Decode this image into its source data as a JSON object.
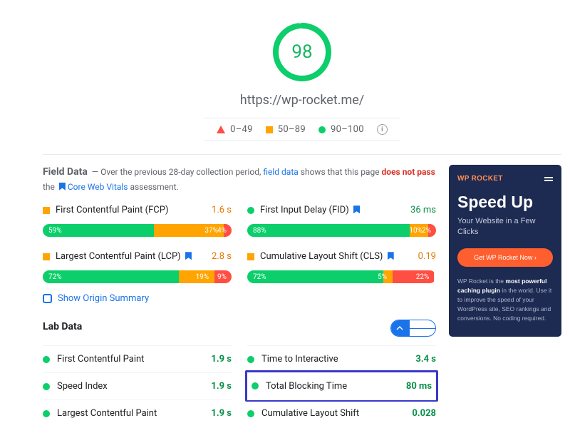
{
  "score": 98,
  "url": "https://wp-rocket.me/",
  "legend": {
    "bad": "0–49",
    "mid": "50–89",
    "good": "90–100"
  },
  "field": {
    "title": "Field Data",
    "intro_1": "— Over the previous 28-day collection period, ",
    "link_1": "field data",
    "intro_2": " shows that this page ",
    "fail": "does not pass",
    "intro_3": " the ",
    "link_2": "Core Web Vitals",
    "intro_4": " assessment."
  },
  "field_metrics": [
    {
      "name": "First Contentful Paint (FCP)",
      "value": "1.6 s",
      "color": "orange",
      "bookmark": false,
      "marker": "sq",
      "dist": [
        [
          "59%",
          59
        ],
        [
          "37%",
          37
        ],
        [
          "4%",
          4
        ]
      ]
    },
    {
      "name": "First Input Delay (FID)",
      "value": "36 ms",
      "color": "green",
      "bookmark": true,
      "marker": "circ",
      "dist": [
        [
          "88%",
          88
        ],
        [
          "10%",
          10
        ],
        [
          "2%",
          2
        ]
      ]
    },
    {
      "name": "Largest Contentful Paint (LCP)",
      "value": "2.8 s",
      "color": "orange",
      "bookmark": true,
      "marker": "sq",
      "dist": [
        [
          "72%",
          72
        ],
        [
          "19%",
          19
        ],
        [
          "9%",
          9
        ]
      ]
    },
    {
      "name": "Cumulative Layout Shift (CLS)",
      "value": "0.19",
      "color": "orange",
      "bookmark": true,
      "marker": "sq",
      "dist": [
        [
          "72%",
          72
        ],
        [
          "5%",
          5
        ],
        [
          "22%",
          22
        ]
      ]
    }
  ],
  "origin": "Show Origin Summary",
  "lab": {
    "title": "Lab Data"
  },
  "lab_metrics": [
    {
      "name": "First Contentful Paint",
      "value": "1.9 s",
      "color": "green",
      "highlight": false
    },
    {
      "name": "Time to Interactive",
      "value": "3.4 s",
      "color": "green",
      "highlight": false
    },
    {
      "name": "Speed Index",
      "value": "1.9 s",
      "color": "green",
      "highlight": false
    },
    {
      "name": "Total Blocking Time",
      "value": "80 ms",
      "color": "green",
      "highlight": true
    },
    {
      "name": "Largest Contentful Paint",
      "value": "1.9 s",
      "color": "green",
      "highlight": false
    },
    {
      "name": "Cumulative Layout Shift",
      "value": "0.028",
      "color": "green",
      "highlight": false
    }
  ],
  "phone": {
    "brand": "WP ROCKET",
    "headline": "Speed Up",
    "sub": "Your Website in a Few Clicks",
    "cta": "Get WP Rocket Now ›",
    "blurb_1": "WP Rocket is the ",
    "blurb_bold": "most powerful caching plugin",
    "blurb_2": " in the world. Use it to improve the speed of your WordPress site, SEO rankings and conversions. No coding required."
  }
}
